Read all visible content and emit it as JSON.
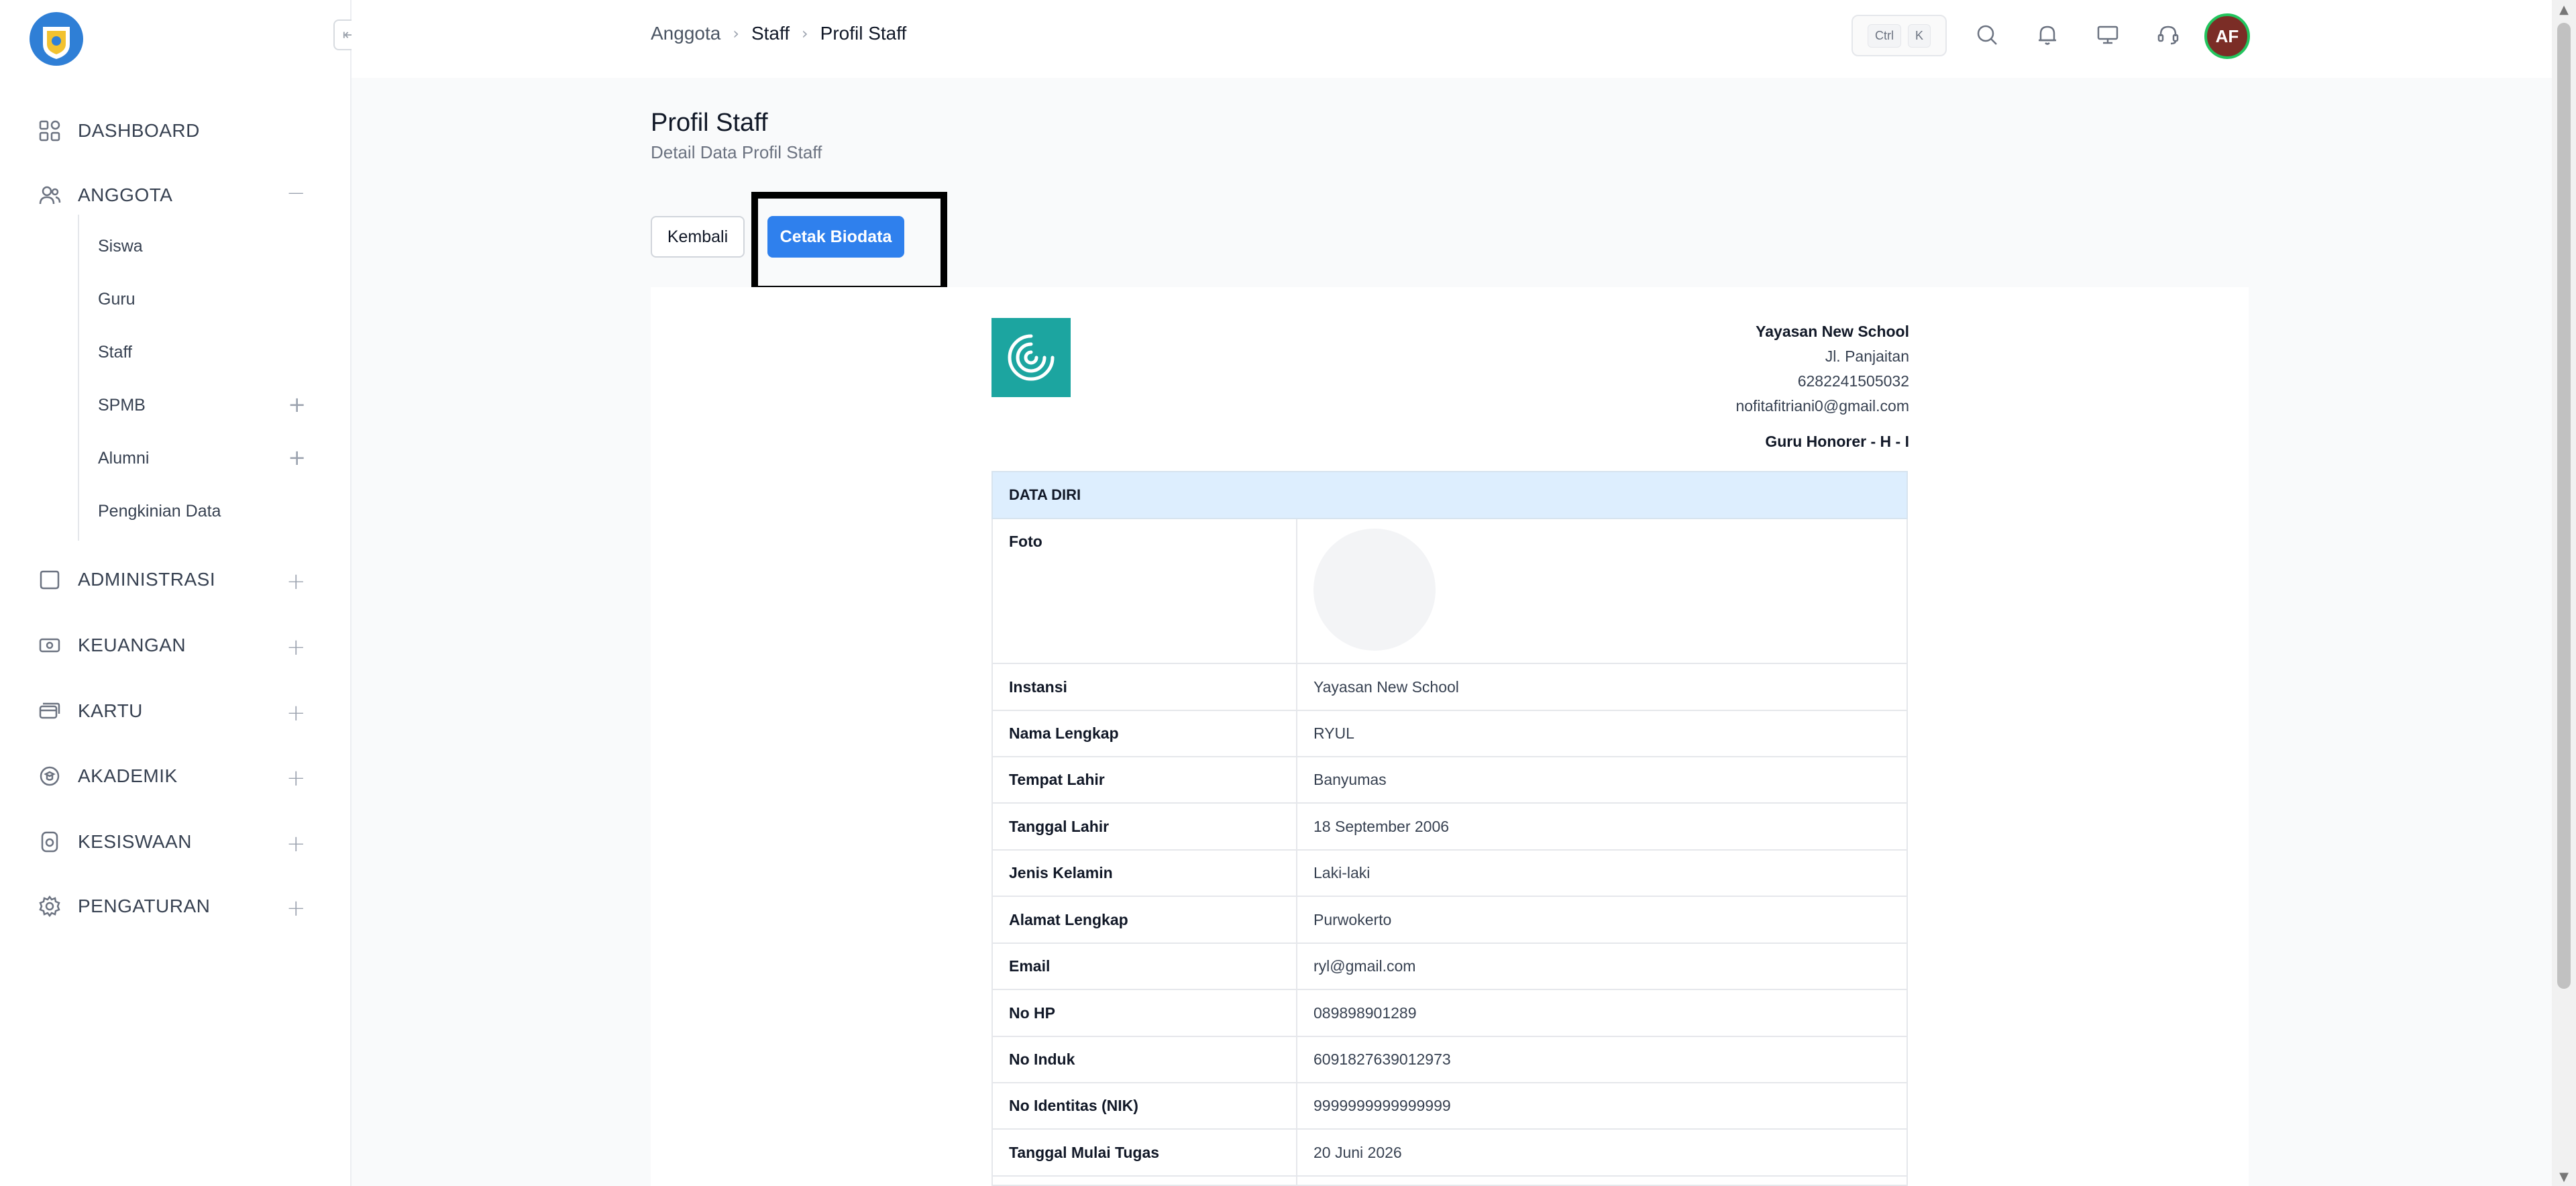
{
  "sidebar": {
    "items": [
      {
        "label": "DASHBOARD"
      },
      {
        "label": "ANGGOTA"
      },
      {
        "label": "ADMINISTRASI"
      },
      {
        "label": "KEUANGAN"
      },
      {
        "label": "KARTU"
      },
      {
        "label": "AKADEMIK"
      },
      {
        "label": "KESISWAAN"
      },
      {
        "label": "PENGATURAN"
      }
    ],
    "anggota_sub": [
      {
        "label": "Siswa"
      },
      {
        "label": "Guru"
      },
      {
        "label": "Staff"
      },
      {
        "label": "SPMB"
      },
      {
        "label": "Alumni"
      },
      {
        "label": "Pengkinian Data"
      }
    ]
  },
  "breadcrumb": [
    "Anggota",
    "Staff",
    "Profil Staff"
  ],
  "shortcut": {
    "key1": "Ctrl",
    "key2": "K"
  },
  "user": {
    "initials": "AF"
  },
  "page": {
    "title": "Profil Staff",
    "subtitle": "Detail Data Profil Staff"
  },
  "actions": {
    "back": "Kembali",
    "print": "Cetak Biodata"
  },
  "institution": {
    "name": "Yayasan New School",
    "address": "Jl. Panjaitan",
    "phone": "6282241505032",
    "email": "nofitafitriani0@gmail.com",
    "role": "Guru Honorer - H - I"
  },
  "section_title": "DATA DIRI",
  "fields": [
    {
      "label": "Foto",
      "value": ""
    },
    {
      "label": "Instansi",
      "value": "Yayasan New School"
    },
    {
      "label": "Nama Lengkap",
      "value": "RYUL"
    },
    {
      "label": "Tempat Lahir",
      "value": "Banyumas"
    },
    {
      "label": "Tanggal Lahir",
      "value": "18 September 2006"
    },
    {
      "label": "Jenis Kelamin",
      "value": "Laki-laki"
    },
    {
      "label": "Alamat Lengkap",
      "value": "Purwokerto"
    },
    {
      "label": "Email",
      "value": "ryl@gmail.com"
    },
    {
      "label": "No HP",
      "value": "089898901289"
    },
    {
      "label": "No Induk",
      "value": "6091827639012973"
    },
    {
      "label": "No Identitas (NIK)",
      "value": "9999999999999999"
    },
    {
      "label": "Tanggal Mulai Tugas",
      "value": "20 Juni 2026"
    }
  ],
  "colors": {
    "primary": "#2f80ed",
    "header_bg": "#ddeefe",
    "logo_bg": "#1ca5a0",
    "avatar_bg": "#7b2d26"
  }
}
